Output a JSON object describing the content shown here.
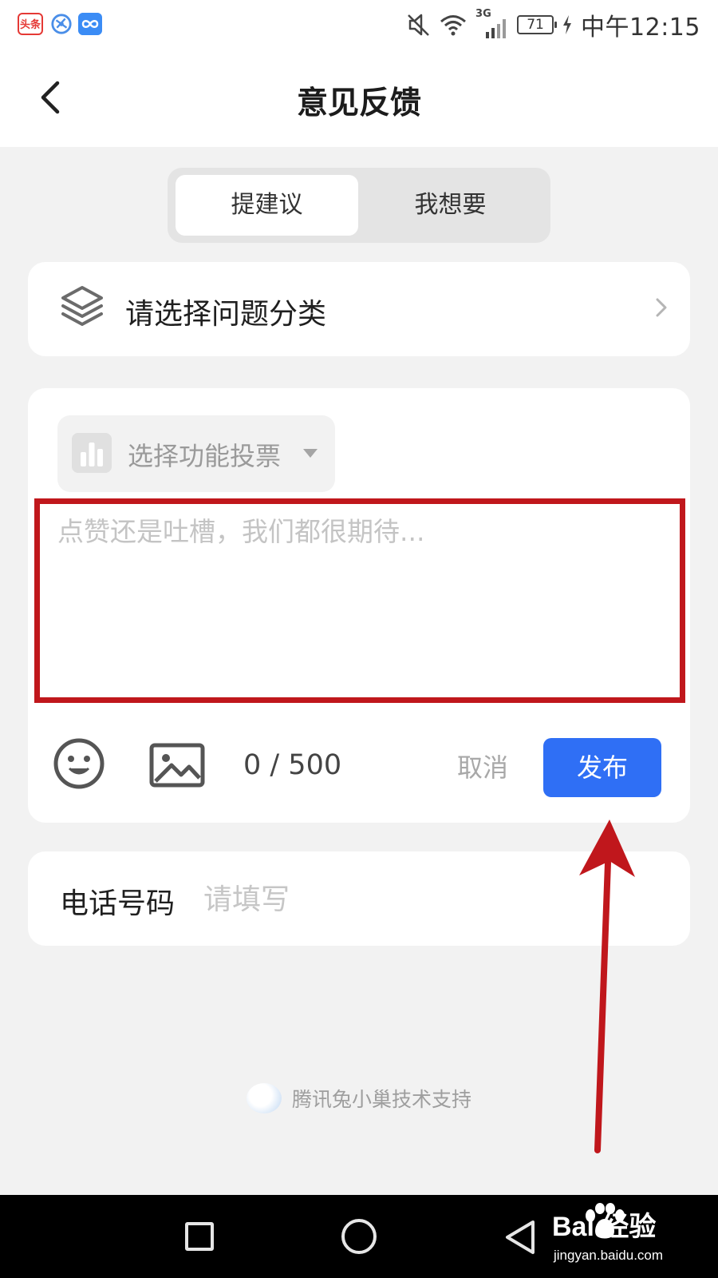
{
  "status_bar": {
    "app_badge": "头条",
    "network_type": "3G",
    "battery": "71",
    "time": "中午12:15"
  },
  "header": {
    "title": "意见反馈"
  },
  "tabs": [
    {
      "label": "提建议",
      "active": true
    },
    {
      "label": "我想要",
      "active": false
    }
  ],
  "category": {
    "label": "请选择问题分类",
    "icon": "layers-icon"
  },
  "feedback": {
    "vote_label": "选择功能投票",
    "textarea_placeholder": "点赞还是吐槽，我们都很期待...",
    "textarea_value": "",
    "char_count": "0 / 500",
    "cancel_label": "取消",
    "publish_label": "发布"
  },
  "phone": {
    "label": "电话号码",
    "placeholder": "请填写",
    "value": ""
  },
  "footer": {
    "support_text": "腾讯兔小巢技术支持"
  },
  "watermark": {
    "brand": "Bai  经验",
    "url": "jingyan.baidu.com"
  },
  "colors": {
    "accent": "#2f6ff5",
    "annotation": "#c0171c",
    "page_bg": "#f2f2f2"
  }
}
